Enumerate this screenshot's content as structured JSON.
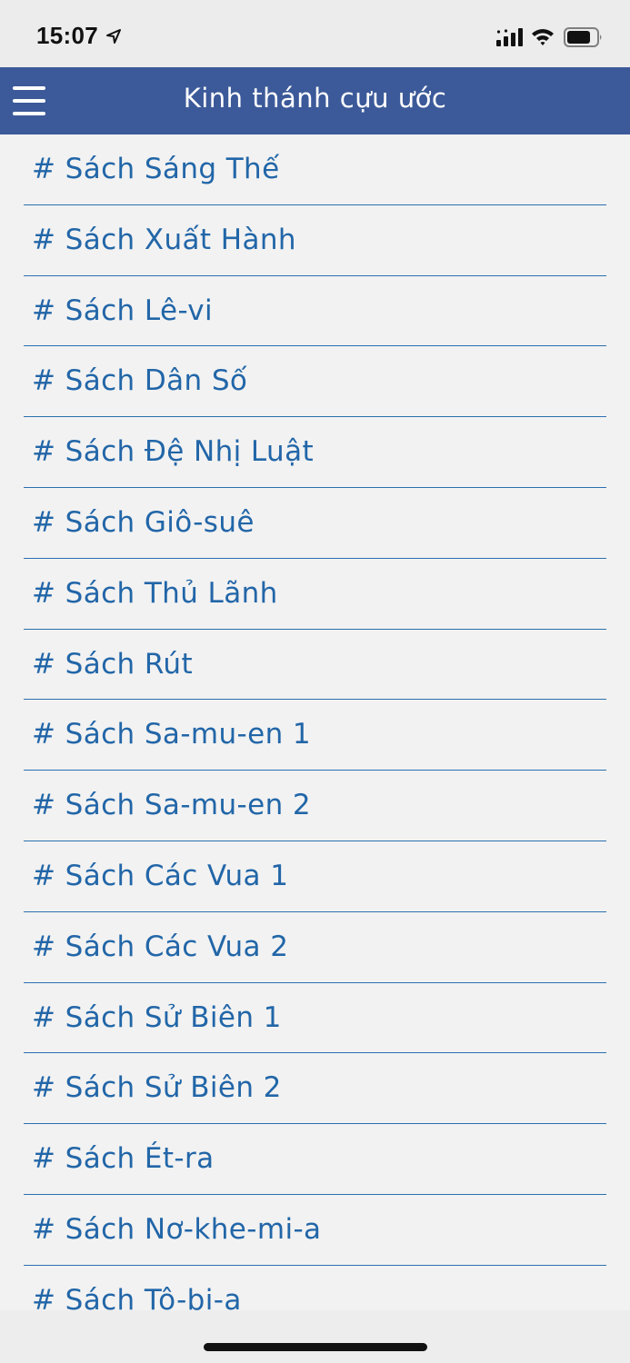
{
  "status_bar": {
    "time": "15:07",
    "icons": [
      "location-arrow-icon",
      "cellular-signal-icon",
      "wifi-icon",
      "battery-icon"
    ]
  },
  "header": {
    "title": "Kinh thánh cựu ước",
    "menu_icon": "hamburger-menu-icon",
    "background_color": "#3c5a99"
  },
  "colors": {
    "accent_text": "#2266a8",
    "divider": "#2a70b0",
    "list_background": "#f2f2f2"
  },
  "books": [
    "# Sách Sáng Thế",
    "# Sách Xuất Hành",
    "# Sách Lê-vi",
    "# Sách Dân Số",
    "# Sách Đệ Nhị Luật",
    "# Sách Giô-suê",
    "# Sách Thủ Lãnh",
    "# Sách Rút",
    "# Sách Sa-mu-en 1",
    "# Sách Sa-mu-en 2",
    "# Sách Các Vua 1",
    "# Sách Các Vua 2",
    "# Sách Sử Biên 1",
    "# Sách Sử Biên 2",
    "# Sách Ét-ra",
    "# Sách Nơ-khe-mi-a",
    "# Sách Tô-bi-a"
  ]
}
